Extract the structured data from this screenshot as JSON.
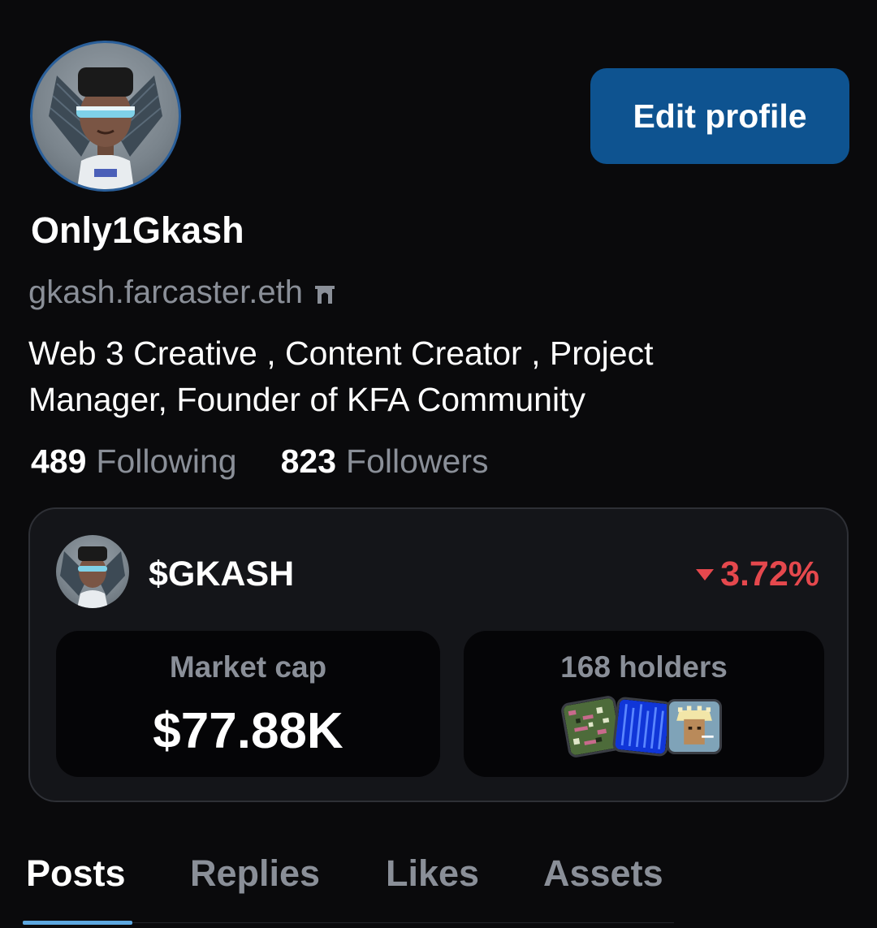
{
  "profile": {
    "display_name": "Only1Gkash",
    "handle": "gkash.farcaster.eth",
    "handle_icon": "arch-icon",
    "bio": "Web 3 Creative , Content Creator , Project Manager, Founder of KFA Community",
    "edit_label": "Edit profile"
  },
  "stats": {
    "following_count": "489",
    "following_label": "Following",
    "followers_count": "823",
    "followers_label": "Followers"
  },
  "token": {
    "symbol": "$GKASH",
    "change": "3.72%",
    "change_direction": "down",
    "change_color": "#e5484d",
    "market_cap_label": "Market cap",
    "market_cap_value": "$77.88K",
    "holders_label": "168 holders"
  },
  "tabs": [
    {
      "label": "Posts",
      "active": true
    },
    {
      "label": "Replies",
      "active": false
    },
    {
      "label": "Likes",
      "active": false
    },
    {
      "label": "Assets",
      "active": false
    }
  ],
  "colors": {
    "background": "#0a0a0c",
    "accent": "#0e5390",
    "tab_indicator": "#5ca7e0",
    "muted_text": "#8a8f98"
  }
}
